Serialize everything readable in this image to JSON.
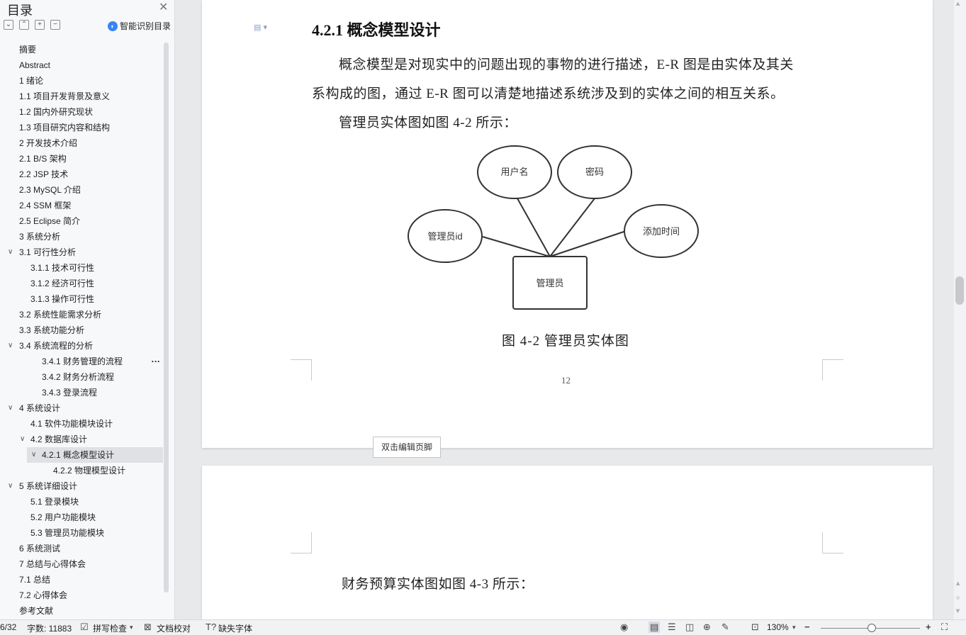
{
  "sidebar": {
    "title": "目录",
    "smart_toc": "智能识别目录",
    "items": [
      {
        "label": "摘要"
      },
      {
        "label": "Abstract"
      },
      {
        "label": "1 绪论"
      },
      {
        "label": "1.1 项目开发背景及意义"
      },
      {
        "label": "1.2 国内外研究现状"
      },
      {
        "label": "1.3 项目研究内容和结构"
      },
      {
        "label": "2 开发技术介绍"
      },
      {
        "label": "2.1 B/S 架构"
      },
      {
        "label": "2.2 JSP 技术"
      },
      {
        "label": "2.3 MySQL 介绍"
      },
      {
        "label": "2.4 SSM 框架"
      },
      {
        "label": "2.5 Eclipse 简介"
      },
      {
        "label": "3 系统分析"
      },
      {
        "label": "3.1 可行性分析"
      },
      {
        "label": "3.1.1 技术可行性"
      },
      {
        "label": "3.1.2 经济可行性"
      },
      {
        "label": "3.1.3 操作可行性"
      },
      {
        "label": "3.2 系统性能需求分析"
      },
      {
        "label": "3.3 系统功能分析"
      },
      {
        "label": "3.4 系统流程的分析"
      },
      {
        "label": "3.4.1 财务管理的流程"
      },
      {
        "label": "3.4.2 财务分析流程"
      },
      {
        "label": "3.4.3 登录流程"
      },
      {
        "label": "4 系统设计"
      },
      {
        "label": "4.1 软件功能模块设计"
      },
      {
        "label": "4.2 数据库设计"
      },
      {
        "label": "4.2.1 概念模型设计"
      },
      {
        "label": "4.2.2 物理模型设计"
      },
      {
        "label": "5 系统详细设计"
      },
      {
        "label": "5.1 登录模块"
      },
      {
        "label": "5.2 用户功能模块"
      },
      {
        "label": "5.3 管理员功能模块"
      },
      {
        "label": "6 系统测试"
      },
      {
        "label": "7 总结与心得体会"
      },
      {
        "label": "7.1 总结"
      },
      {
        "label": "7.2 心得体会"
      },
      {
        "label": "参考文献"
      }
    ]
  },
  "document": {
    "heading": "4.2.1 概念模型设计",
    "para1_line1": "概念模型是对现实中的问题出现的事物的进行描述，E-R 图是由实体及其关",
    "para1_line2": "系构成的图，通过 E-R 图可以清楚地描述系统涉及到的实体之间的相互关系。",
    "para2": "管理员实体图如图 4-2 所示：",
    "figure": {
      "entity": "管理员",
      "attributes": [
        "用户名",
        "密码",
        "管理员id",
        "添加时间"
      ]
    },
    "caption": "图 4-2 管理员实体图",
    "page_number": "12",
    "footer_tip": "双击编辑页脚",
    "page2_para": "财务预算实体图如图 4-3 所示："
  },
  "status": {
    "page": "6/32",
    "word_count": "字数: 11883",
    "spell_check": "拼写检查",
    "doc_proof": "文档校对",
    "missing_font": "缺失字体",
    "zoom": "130%"
  }
}
